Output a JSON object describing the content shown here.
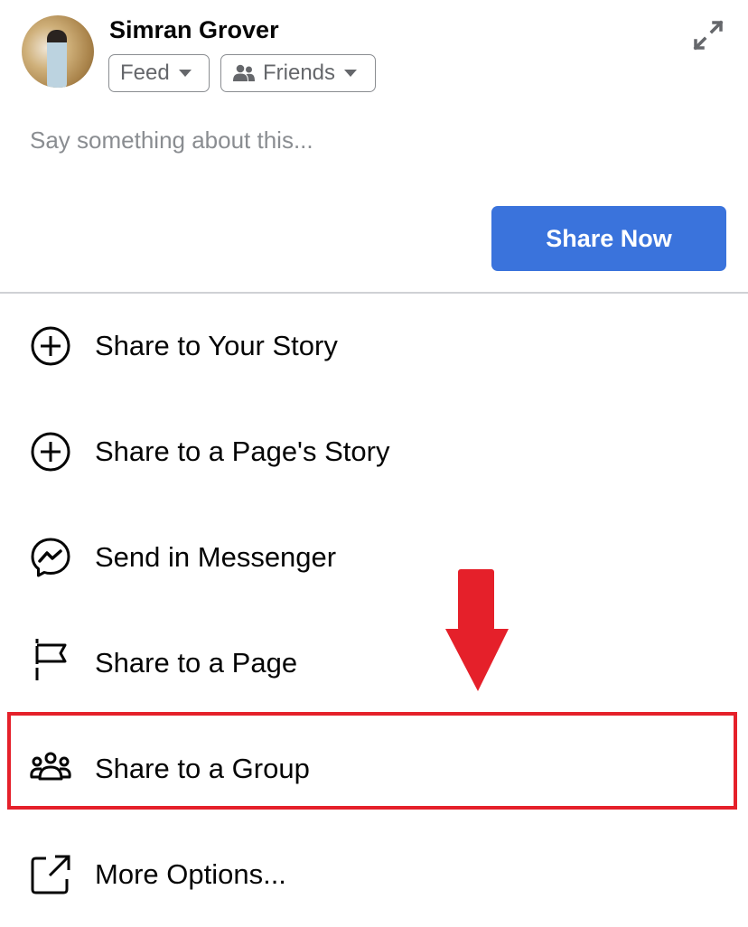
{
  "composer": {
    "user_name": "Simran Grover",
    "audience_feed_label": "Feed",
    "audience_privacy_label": "Friends",
    "post_placeholder": "Say something about this...",
    "post_value": "",
    "share_now_label": "Share Now"
  },
  "share_menu": {
    "items": [
      {
        "label": "Share to Your Story",
        "icon": "plus-circle-icon"
      },
      {
        "label": "Share to a Page's Story",
        "icon": "plus-circle-icon"
      },
      {
        "label": "Send in Messenger",
        "icon": "messenger-icon"
      },
      {
        "label": "Share to a Page",
        "icon": "flag-icon"
      },
      {
        "label": "Share to a Group",
        "icon": "group-icon"
      },
      {
        "label": "More Options...",
        "icon": "external-share-icon"
      }
    ]
  },
  "annotation": {
    "highlighted_item": "Share to a Group",
    "color": "#e5202a"
  },
  "colors": {
    "primary_button": "#3a73dc",
    "secondary_text": "#65676b",
    "placeholder_text": "#8a8d91"
  }
}
